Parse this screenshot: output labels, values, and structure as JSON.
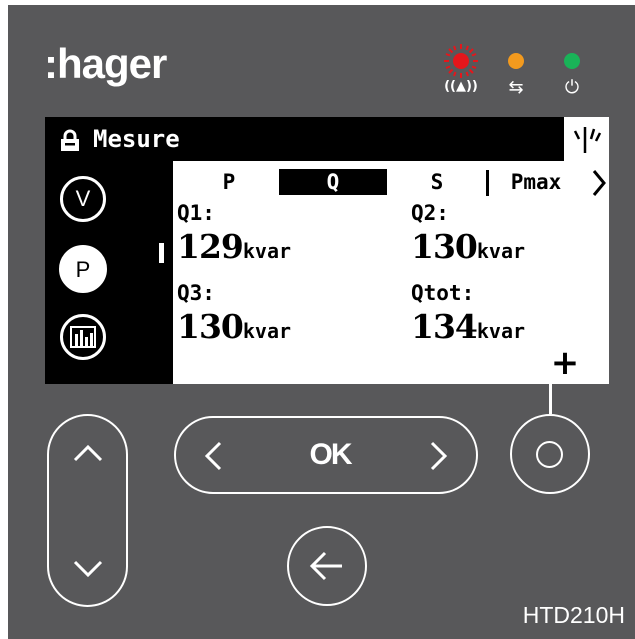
{
  "brand": {
    "logo": ":hager"
  },
  "leds": [
    {
      "name": "alarm",
      "color": "#e5161b",
      "symbol": "((▲))"
    },
    {
      "name": "communication",
      "color": "#f39a1e",
      "symbol": "⇆"
    },
    {
      "name": "power",
      "color": "#19b358",
      "symbol": "⏻"
    }
  ],
  "screen": {
    "title": "Mesure",
    "sidebar": [
      "V",
      "P",
      "chart"
    ],
    "active_sidebar": "P",
    "tabs": [
      "P",
      "Q",
      "S",
      "Pmax"
    ],
    "active_tab": "Q",
    "measures": [
      {
        "label": "Q1:",
        "value": "129",
        "unit": "kvar"
      },
      {
        "label": "Q2:",
        "value": "130",
        "unit": "kvar"
      },
      {
        "label": "Q3:",
        "value": "130",
        "unit": "kvar"
      },
      {
        "label": "Qtot:",
        "value": "134",
        "unit": "kvar"
      }
    ],
    "more_symbol": "+"
  },
  "buttons": {
    "ok": "OK"
  },
  "model": "HTD210H"
}
